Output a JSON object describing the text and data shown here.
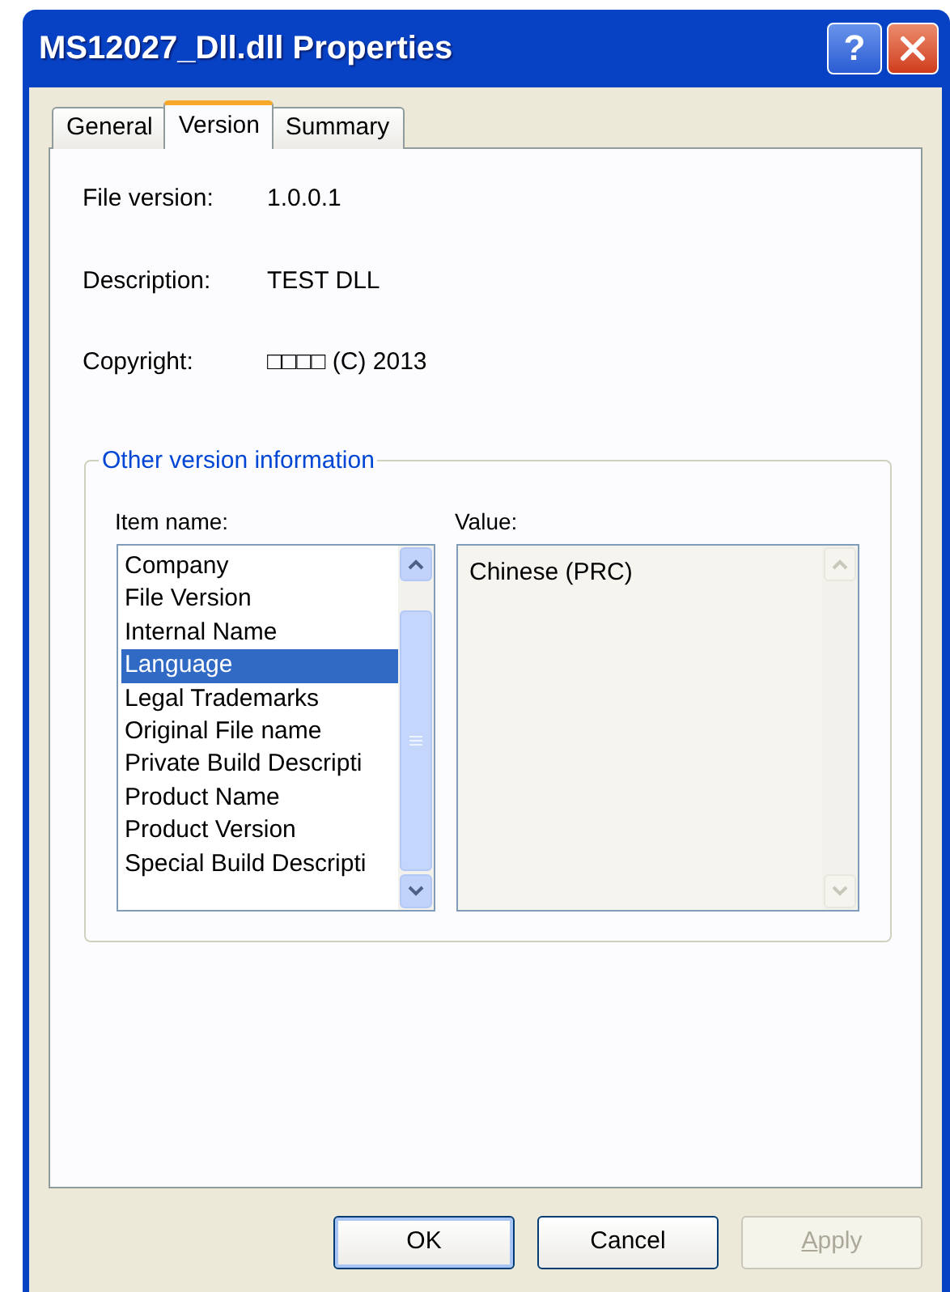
{
  "window": {
    "title": "MS12027_Dll.dll Properties",
    "controls": [
      "?"
    ]
  },
  "tabs": [
    {
      "label": "General",
      "selected": false
    },
    {
      "label": "Version",
      "selected": true
    },
    {
      "label": "Summary",
      "selected": false
    }
  ],
  "fields": [
    {
      "label": "File version:",
      "value": "1.0.0.1"
    },
    {
      "label": "Description:",
      "value": "TEST DLL"
    },
    {
      "label": "Copyright:",
      "value": "□□□□ (C) 2013"
    }
  ],
  "group": {
    "title": "Other version information",
    "item_label": "Item name:",
    "value_label": "Value:",
    "items": [
      {
        "label": "Company",
        "selected": false
      },
      {
        "label": "File Version",
        "selected": false
      },
      {
        "label": "Internal Name",
        "selected": false
      },
      {
        "label": "Language",
        "selected": true
      },
      {
        "label": "Legal Trademarks",
        "selected": false
      },
      {
        "label": "Original File name",
        "selected": false
      },
      {
        "label": "Private Build Descripti",
        "selected": false
      },
      {
        "label": "Product Name",
        "selected": false
      },
      {
        "label": "Product Version",
        "selected": false
      },
      {
        "label": "Special Build Descripti",
        "selected": false
      }
    ],
    "value": "Chinese (PRC)"
  },
  "buttons": [
    {
      "label": "OK",
      "disabled": false,
      "default": true
    },
    {
      "label": "Cancel",
      "disabled": false,
      "default": false
    },
    {
      "label": "Apply",
      "disabled": true,
      "default": false
    }
  ]
}
